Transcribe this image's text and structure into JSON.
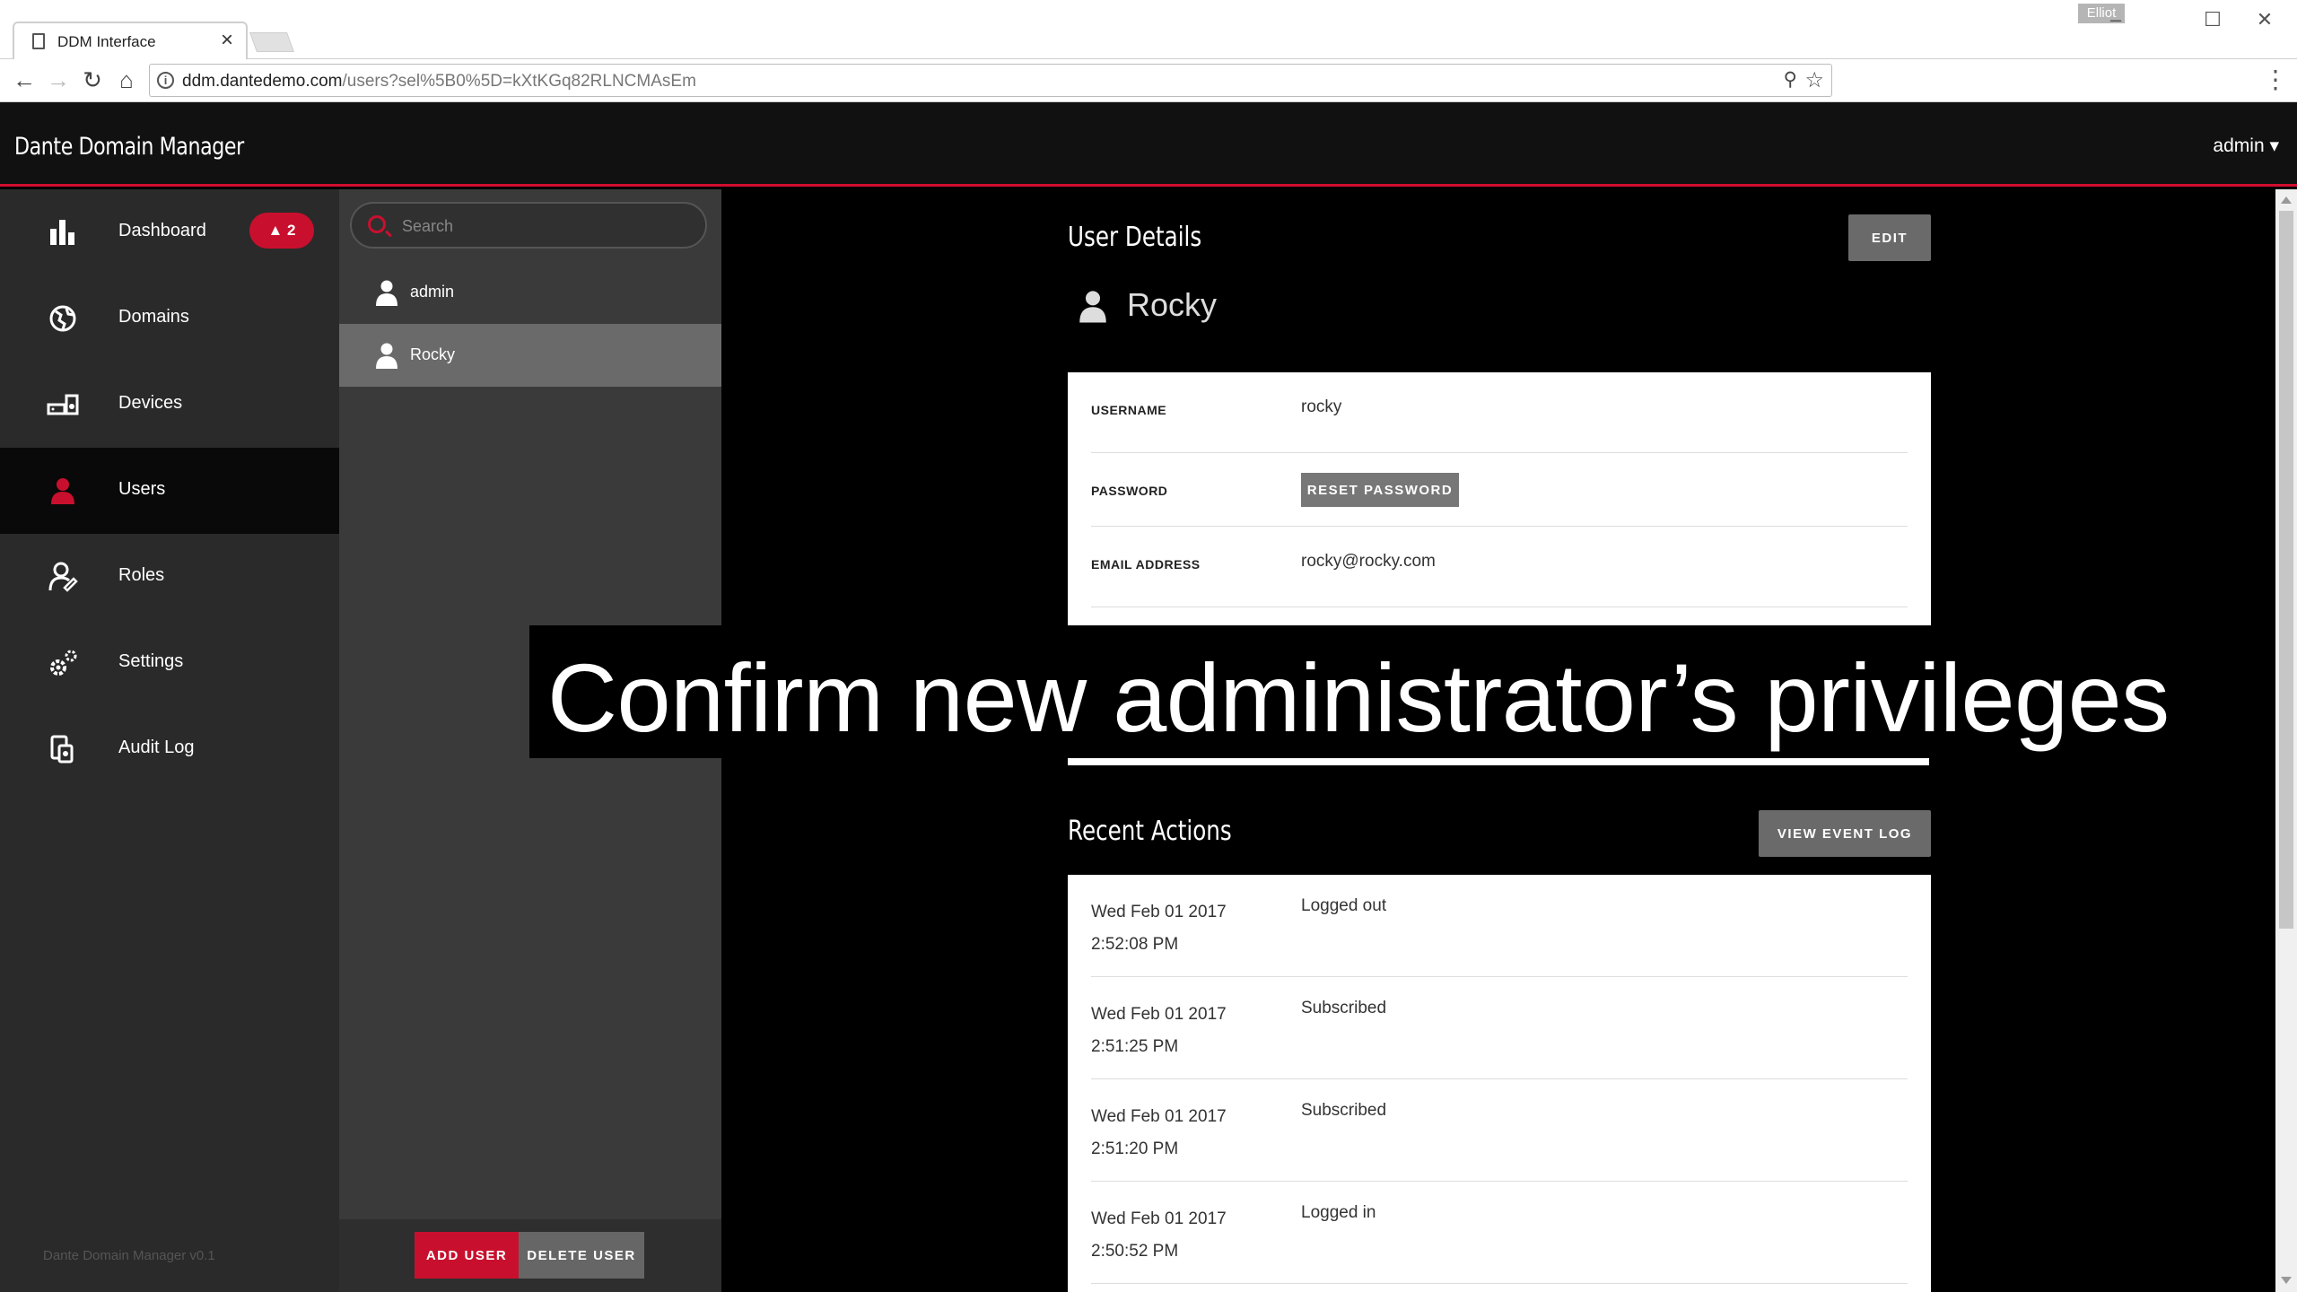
{
  "browser": {
    "tab_title": "DDM Interface",
    "profile_name": "Elliot",
    "url_host": "ddm.dantedemo.com",
    "url_path": "/users?sel%5B0%5D=kXtKGq82RLNCMAsEm"
  },
  "app": {
    "brand": "Dante Domain Manager",
    "user_menu": "admin ▾",
    "version": "Dante Domain Manager v0.1"
  },
  "sidebar": {
    "items": [
      {
        "label": "Dashboard",
        "icon": "bar-chart-icon",
        "badge": "▲ 2"
      },
      {
        "label": "Domains",
        "icon": "globe-icon"
      },
      {
        "label": "Devices",
        "icon": "devices-icon"
      },
      {
        "label": "Users",
        "icon": "user-icon",
        "active": true
      },
      {
        "label": "Roles",
        "icon": "roles-icon"
      },
      {
        "label": "Settings",
        "icon": "gears-icon"
      },
      {
        "label": "Audit Log",
        "icon": "audit-log-icon"
      }
    ]
  },
  "user_list": {
    "search_placeholder": "Search",
    "users": [
      {
        "name": "admin"
      },
      {
        "name": "Rocky",
        "selected": true
      }
    ],
    "add_label": "ADD USER",
    "delete_label": "DELETE USER"
  },
  "user_details": {
    "title": "User Details",
    "edit_label": "EDIT",
    "name": "Rocky",
    "username_label": "USERNAME",
    "username_value": "rocky",
    "password_label": "PASSWORD",
    "reset_label": "RESET PASSWORD",
    "email_label": "EMAIL ADDRESS",
    "email_value": "rocky@rocky.com"
  },
  "recent_actions": {
    "title": "Recent Actions",
    "view_log_label": "VIEW EVENT LOG",
    "rows": [
      {
        "date": "Wed Feb 01 2017",
        "time": "2:52:08 PM",
        "action": "Logged out"
      },
      {
        "date": "Wed Feb 01 2017",
        "time": "2:51:25 PM",
        "action": "Subscribed"
      },
      {
        "date": "Wed Feb 01 2017",
        "time": "2:51:20 PM",
        "action": "Subscribed"
      },
      {
        "date": "Wed Feb 01 2017",
        "time": "2:50:52 PM",
        "action": "Logged in"
      }
    ]
  },
  "caption": "Confirm new administrator’s privileges",
  "colors": {
    "accent": "#c8102e",
    "sidebar_bg": "#2a2a2a",
    "list_bg": "#3a3a3a"
  }
}
